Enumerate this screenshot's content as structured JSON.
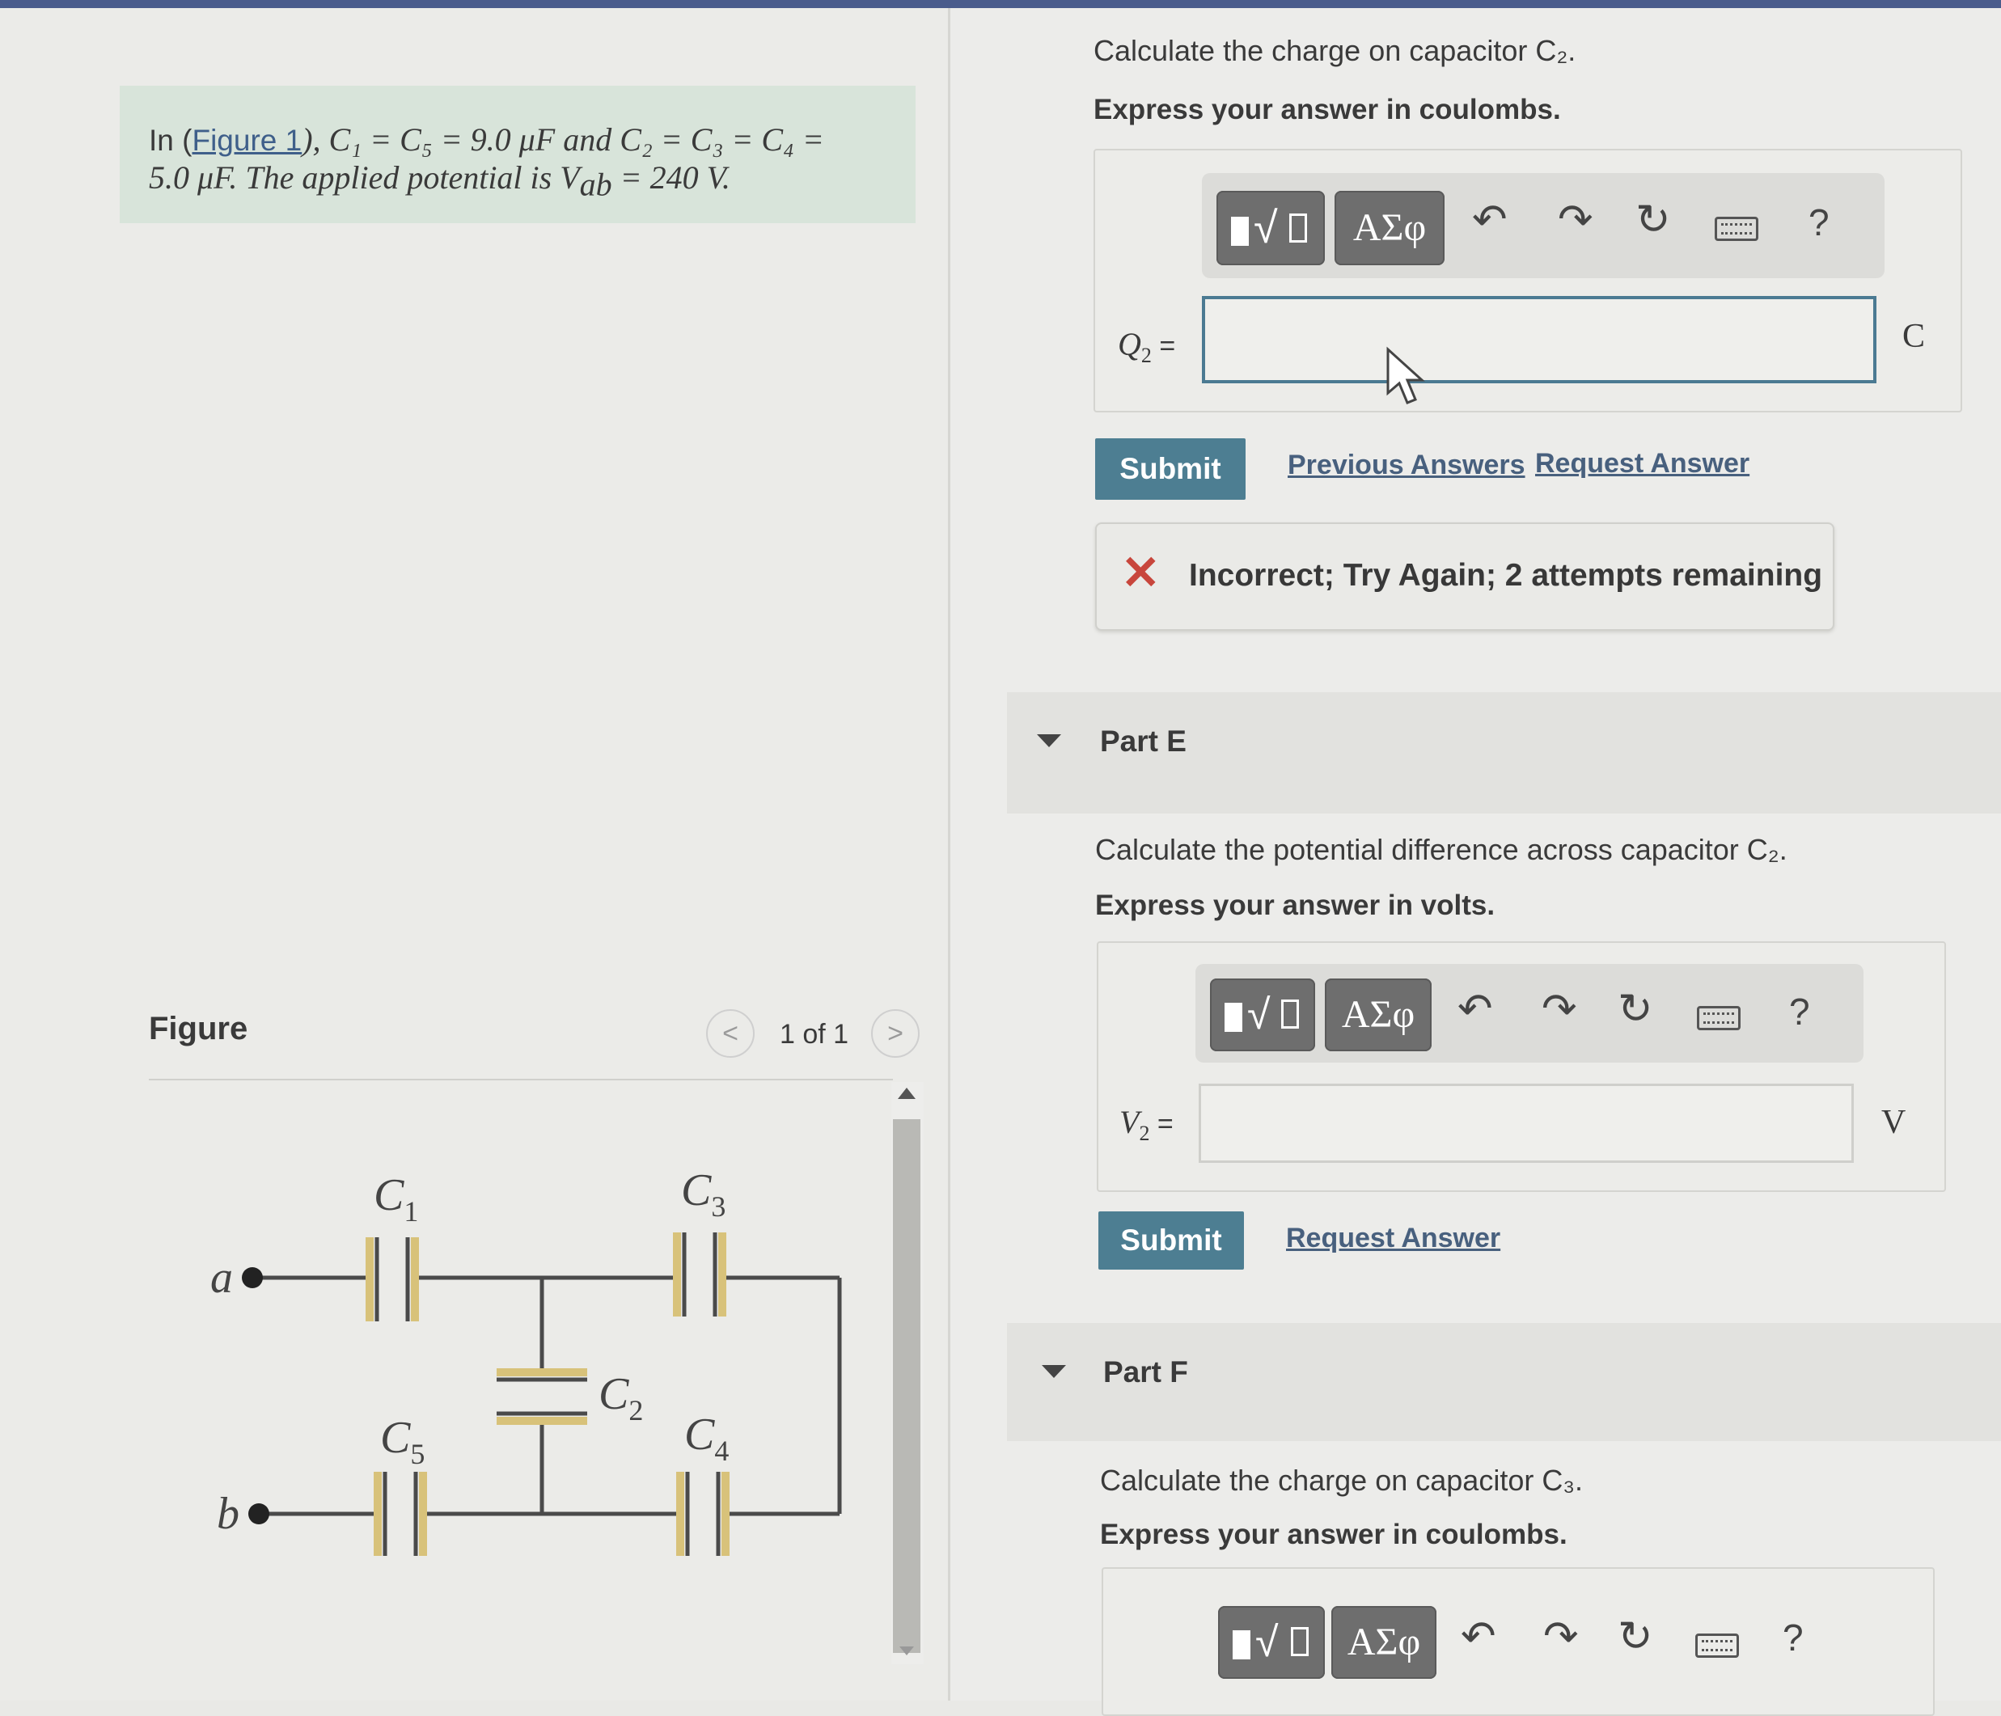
{
  "problem": {
    "prefix": "In (",
    "figure_link": "Figure 1",
    "line1_rest": "), C₁ = C₅ = 9.0 μF and C₂ = C₃ = C₄ =",
    "line2": "5.0 μF. The applied potential is V",
    "line2_sub": "ab",
    "line2_end": " = 240 V."
  },
  "figure": {
    "title": "Figure",
    "pager": "1 of 1",
    "prev": "<",
    "next": ">",
    "labels": {
      "c1": "C",
      "c1_sub": "1",
      "c2": "C",
      "c2_sub": "2",
      "c3": "C",
      "c3_sub": "3",
      "c4": "C",
      "c4_sub": "4",
      "c5": "C",
      "c5_sub": "5",
      "a": "a",
      "b": "b"
    }
  },
  "toolbar": {
    "templates": "√",
    "symbols": "ΑΣφ",
    "undo": "↶",
    "redo": "↷",
    "reset": "↻",
    "keyboard": "keyboard-icon",
    "help": "?"
  },
  "partD": {
    "question": "Calculate the charge on capacitor C₂.",
    "instruction": "Express your answer in coulombs.",
    "var": "Q",
    "var_sub": "2",
    "eq": " =",
    "value": "",
    "unit": "C",
    "submit": "Submit",
    "previous_answers": "Previous Answers",
    "request_answer": "Request Answer",
    "feedback_mark": "✕",
    "feedback": "Incorrect; Try Again; 2 attempts remaining"
  },
  "partE": {
    "title": "Part E",
    "question": "Calculate the potential difference across capacitor C₂.",
    "instruction": "Express your answer in volts.",
    "var": "V",
    "var_sub": "2",
    "eq": " =",
    "value": "",
    "unit": "V",
    "submit": "Submit",
    "request_answer": "Request Answer"
  },
  "partF": {
    "title": "Part F",
    "question": "Calculate the charge on capacitor C₃.",
    "instruction": "Express your answer in coulombs."
  },
  "colors": {
    "accent": "#4d7e92",
    "intro_bg": "#d8e4da",
    "error": "#c8463c",
    "plate": "#d8c27a"
  }
}
